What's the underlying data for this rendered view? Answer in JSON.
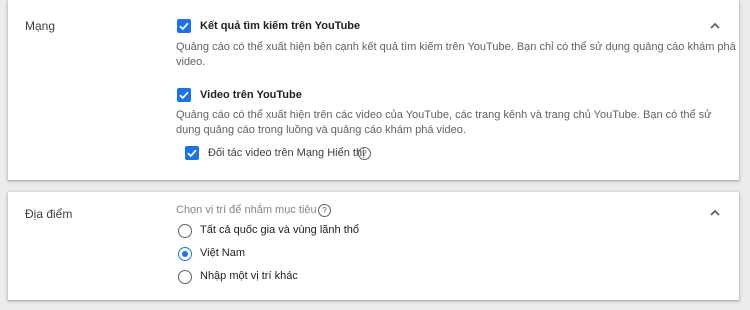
{
  "network_section": {
    "title": "Mạng",
    "options": [
      {
        "label": "Kết quả tìm kiếm trên YouTube",
        "checked": true,
        "description": "Quảng cáo có thể xuất hiện bên cạnh kết quả tìm kiếm trên YouTube. Bạn chỉ có thể sử dụng quảng cáo khám phá video."
      },
      {
        "label": "Video trên YouTube",
        "checked": true,
        "description": "Quảng cáo có thể xuất hiện trên các video của YouTube, các trang kênh và trang chủ YouTube. Bạn có thể sử dụng quảng cáo trong luồng và quảng cáo khám phá video."
      }
    ],
    "sub_option": {
      "label": "Đối tác video trên Mạng Hiển thị",
      "checked": true
    },
    "help_icon": "?"
  },
  "location_section": {
    "title": "Địa điểm",
    "prompt": "Chọn vị trí để nhắm mục tiêu",
    "help_icon": "?",
    "options": [
      {
        "label": "Tất cả quốc gia và vùng lãnh thổ",
        "selected": false
      },
      {
        "label": "Việt Nam",
        "selected": true
      },
      {
        "label": "Nhập một vị trí khác",
        "selected": false
      }
    ]
  },
  "icons": {
    "collapse": "chevron-up-icon",
    "check": "checkmark-icon",
    "help": "help-circle-icon"
  },
  "colors": {
    "accent": "#1a73e8",
    "background": "#ececec",
    "card": "#ffffff",
    "secondary_text": "#5f6368"
  }
}
